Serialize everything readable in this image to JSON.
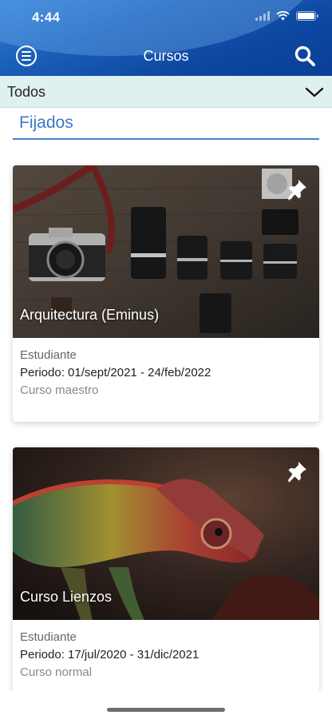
{
  "status_bar": {
    "time": "4:44"
  },
  "header": {
    "title": "Cursos"
  },
  "filter": {
    "selected": "Todos"
  },
  "section": {
    "title": "Fijados"
  },
  "courses": [
    {
      "name": "Arquitectura (Eminus)",
      "role": "Estudiante",
      "period": "Periodo: 01/sept/2021 - 24/feb/2022",
      "type": "Curso maestro",
      "image": "camera-lenses-photo"
    },
    {
      "name": "Curso Lienzos",
      "role": "Estudiante",
      "period": "Periodo: 17/jul/2020 - 31/dic/2021",
      "type": "Curso normal",
      "image": "chameleon-photo"
    }
  ],
  "colors": {
    "header": "#1a5fb8",
    "filter_bar": "#dff1ee",
    "accent": "#3b77c8"
  }
}
